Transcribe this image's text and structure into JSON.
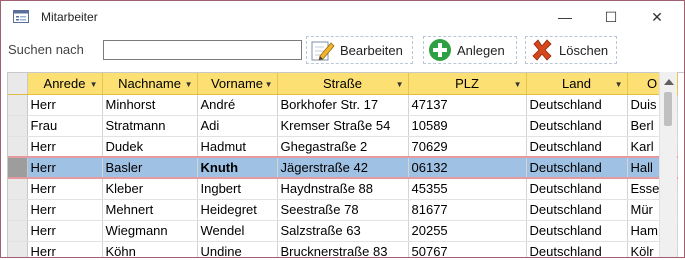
{
  "window": {
    "title": "Mitarbeiter",
    "controls": {
      "minimize": "—",
      "maximize": "☐",
      "close": "✕"
    }
  },
  "toolbar": {
    "search_label": "Suchen nach",
    "search_value": "",
    "edit_label": "Bearbeiten",
    "add_label": "Anlegen",
    "delete_label": "Löschen"
  },
  "colors": {
    "header": "#fde073",
    "selected_row": "#9fc1e4",
    "add_green": "#2ea043",
    "delete_red": "#d6451b"
  },
  "table": {
    "headers": [
      "Anrede",
      "Nachname",
      "Vorname",
      "Straße",
      "PLZ",
      "Land",
      "O"
    ],
    "rows": [
      [
        "Herr",
        "Minhorst",
        "André",
        "Borkhofer Str. 17",
        "47137",
        "Deutschland",
        "Duis"
      ],
      [
        "Frau",
        "Stratmann",
        "Adi",
        "Kremser Straße 54",
        "10589",
        "Deutschland",
        "Berl"
      ],
      [
        "Herr",
        "Dudek",
        "Hadmut",
        "Ghegastraße 2",
        "70629",
        "Deutschland",
        "Karl"
      ],
      [
        "Herr",
        "Basler",
        "Knuth",
        "Jägerstraße 42",
        "06132",
        "Deutschland",
        "Hall"
      ],
      [
        "Herr",
        "Kleber",
        "Ingbert",
        "Haydnstraße 88",
        "45355",
        "Deutschland",
        "Esse"
      ],
      [
        "Herr",
        "Mehnert",
        "Heidegret",
        "Seestraße 78",
        "81677",
        "Deutschland",
        "Mür"
      ],
      [
        "Herr",
        "Wiegmann",
        "Wendel",
        "Salzstraße 63",
        "20255",
        "Deutschland",
        "Ham"
      ],
      [
        "Herr",
        "Köhn",
        "Undine",
        "Brucknerstraße 83",
        "50767",
        "Deutschland",
        "Kölr"
      ]
    ]
  }
}
